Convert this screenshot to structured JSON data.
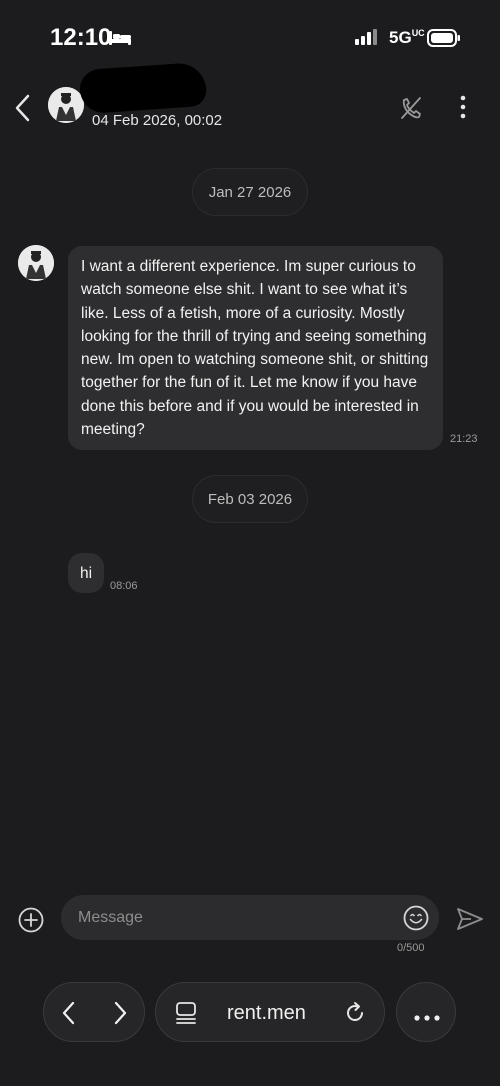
{
  "status_bar": {
    "time": "12:10",
    "network": "5G",
    "network_superscript": "UC",
    "sleep_icon": "bed-icon",
    "signal_icon": "signal-bars-icon",
    "battery_icon": "battery-icon"
  },
  "header": {
    "subtitle": "04 Feb 2026, 00:02",
    "back_icon": "chevron-left-icon",
    "call_icon": "call-off-icon",
    "more_icon": "vertical-dots-icon"
  },
  "messages": {
    "date_1": "Jan 27 2026",
    "msg_1_text": "I want a different experience. Im super curious to watch someone else shit. I want to see what it’s like. Less of a fetish, more of a curiosity. Mostly looking for the thrill of trying and seeing something new. Im open to watching someone shit, or shitting together for the fun of it. Let me know if you have done this before and if you would be interested in meeting?",
    "msg_1_time": "21:23",
    "date_2": "Feb 03 2026",
    "msg_2_text": "hi",
    "msg_2_time": "08:06"
  },
  "composer": {
    "placeholder": "Message",
    "value": "",
    "char_count": "0/500",
    "add_icon": "plus-circle-icon",
    "emoji_icon": "smiley-icon",
    "send_icon": "send-icon"
  },
  "browser": {
    "url": "rent.men",
    "back_icon": "chevron-left-icon",
    "forward_icon": "chevron-right-icon",
    "page_icon": "page-icon",
    "reload_icon": "reload-icon",
    "menu_icon": "horizontal-dots-icon"
  },
  "colors": {
    "background": "#1c1c1e",
    "bubble": "#2e2e30",
    "secondary_text": "#9a9a9a"
  }
}
